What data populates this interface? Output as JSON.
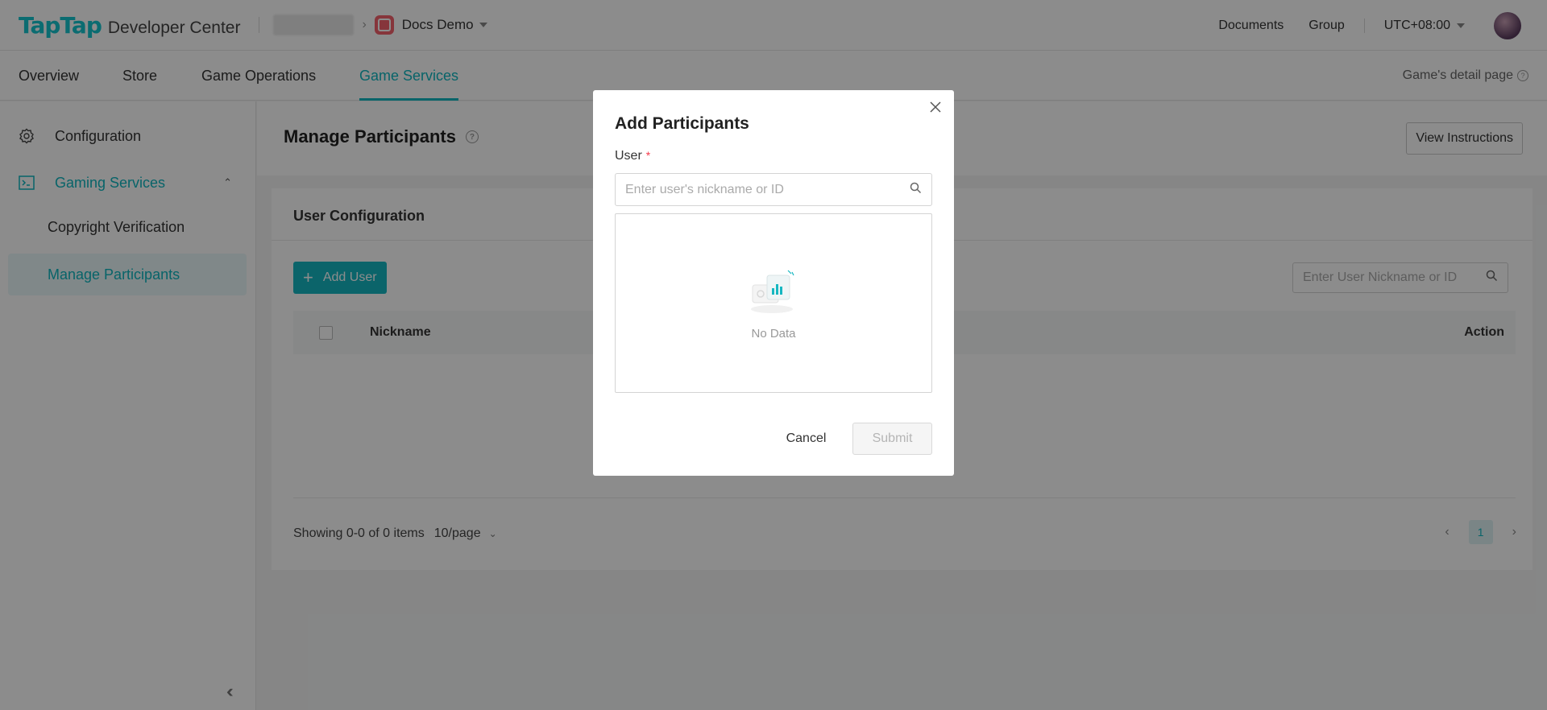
{
  "header": {
    "brand": "TapTap",
    "subtitle": "Developer Center",
    "app_name": "Docs Demo",
    "links": [
      "Documents",
      "Group"
    ],
    "timezone": "UTC+08:00"
  },
  "nav": {
    "tabs": [
      "Overview",
      "Store",
      "Game Operations",
      "Game Services"
    ],
    "active_tab": "Game Services",
    "detail_link": "Game's detail page"
  },
  "sidebar": {
    "items": [
      {
        "label": "Configuration",
        "icon": "gear-icon"
      },
      {
        "label": "Gaming Services",
        "icon": "terminal-icon",
        "expanded": true
      },
      {
        "label": "Copyright Verification"
      },
      {
        "label": "Manage Participants",
        "selected": true
      }
    ]
  },
  "page": {
    "title": "Manage Participants",
    "view_instructions": "View Instructions"
  },
  "card": {
    "title": "User Configuration",
    "add_user": "Add User",
    "search_placeholder": "Enter User Nickname or ID",
    "columns": {
      "nickname": "Nickname",
      "action": "Action"
    },
    "pager": {
      "summary": "Showing 0-0 of 0 items",
      "page_size": "10/page",
      "current_page": "1"
    }
  },
  "modal": {
    "title": "Add Participants",
    "field_label": "User",
    "required_mark": "*",
    "input_placeholder": "Enter user's nickname or ID",
    "empty_text": "No Data",
    "cancel": "Cancel",
    "submit": "Submit"
  },
  "colors": {
    "accent": "#15b7c1",
    "overlay": "rgba(0,0,0,0.45)"
  }
}
